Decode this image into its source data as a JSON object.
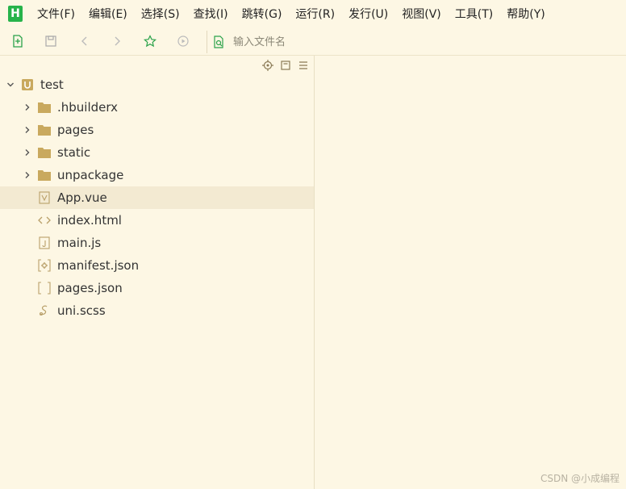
{
  "app": {
    "logo_letter": "H",
    "brand_color": "#27b34a"
  },
  "menu": [
    {
      "label": "文件(F)"
    },
    {
      "label": "编辑(E)"
    },
    {
      "label": "选择(S)"
    },
    {
      "label": "查找(I)"
    },
    {
      "label": "跳转(G)"
    },
    {
      "label": "运行(R)"
    },
    {
      "label": "发行(U)"
    },
    {
      "label": "视图(V)"
    },
    {
      "label": "工具(T)"
    },
    {
      "label": "帮助(Y)"
    }
  ],
  "toolbar": {
    "icons": [
      "new-file-icon",
      "save-icon",
      "back-icon",
      "forward-icon",
      "favorite-star-icon",
      "run-icon",
      "file-search-icon"
    ],
    "search_placeholder": "输入文件名"
  },
  "panel_tools": [
    "locate-icon",
    "collapse-icon",
    "menu-icon"
  ],
  "tree": {
    "root": {
      "label": "test",
      "expanded": true,
      "icon": "uni-project-icon"
    },
    "items": [
      {
        "label": ".hbuilderx",
        "type": "folder"
      },
      {
        "label": "pages",
        "type": "folder"
      },
      {
        "label": "static",
        "type": "folder"
      },
      {
        "label": "unpackage",
        "type": "folder"
      },
      {
        "label": "App.vue",
        "type": "vue-file",
        "selected": true
      },
      {
        "label": "index.html",
        "type": "html-file"
      },
      {
        "label": "main.js",
        "type": "js-file"
      },
      {
        "label": "manifest.json",
        "type": "json-gear-file"
      },
      {
        "label": "pages.json",
        "type": "json-file"
      },
      {
        "label": "uni.scss",
        "type": "scss-file"
      }
    ]
  },
  "watermark": "CSDN @小成编程",
  "colors": {
    "background": "#fdf7e4",
    "selected_row": "#f3ead2",
    "folder": "#c9a95e",
    "icon_tan": "#b9a06a"
  }
}
